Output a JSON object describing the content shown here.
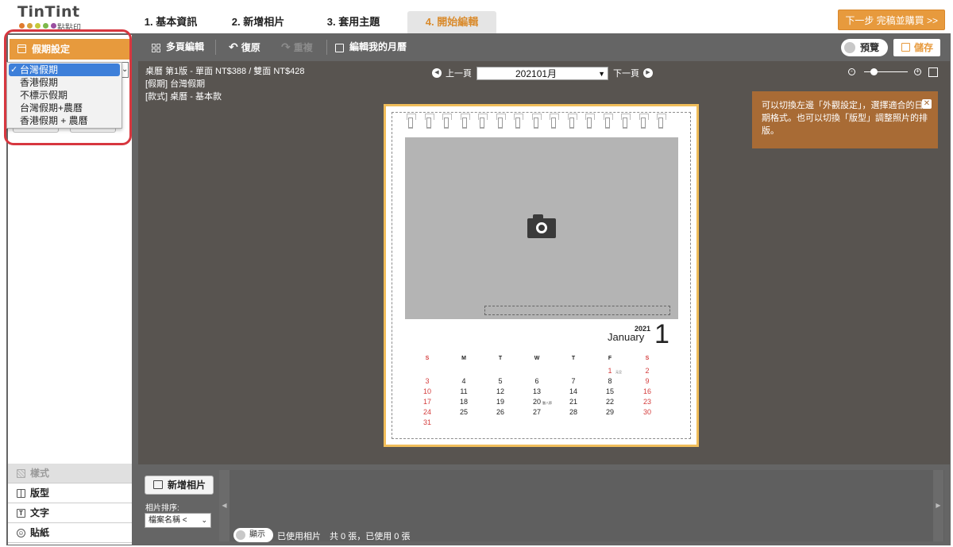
{
  "logo": {
    "text": "TinTint",
    "sub": "點點印",
    "dot_colors": [
      "#e07b2e",
      "#d6a33c",
      "#c5c93a",
      "#7db84b",
      "#9a4fa0"
    ]
  },
  "steps": [
    {
      "label": "1. 基本資訊"
    },
    {
      "label": "2. 新增相片"
    },
    {
      "label": "3. 套用主題"
    },
    {
      "label": "4. 開始編輯"
    }
  ],
  "header": {
    "next_label": "下一步 完稿並購買 >>"
  },
  "toolbar": {
    "multipage": "多頁編輯",
    "undo": "復原",
    "redo": "重複",
    "edit_my_months": "編輯我的月曆",
    "preview": "預覽",
    "save": "儲存"
  },
  "left": {
    "panel_title": "假期設定",
    "holiday_options": [
      {
        "label": "台灣假期",
        "selected": true
      },
      {
        "label": "香港假期"
      },
      {
        "label": "不標示假期"
      },
      {
        "label": "台灣假期+農曆"
      },
      {
        "label": "香港假期 + 農曆"
      }
    ],
    "tabs": [
      {
        "label": "樣式",
        "disabled": true
      },
      {
        "label": "版型"
      },
      {
        "label": "文字"
      },
      {
        "label": "貼紙"
      }
    ]
  },
  "canvas": {
    "info_lines": [
      "桌曆 第1版 - 單面 NT$388 / 雙面 NT$428",
      "[假期] 台灣假期",
      "[款式] 桌曆 - 基本款"
    ],
    "prev_page": "上一頁",
    "next_page": "下一頁",
    "month_select": "202101月",
    "tooltip": "可以切換左邊「外觀設定」，選擇適合的日期格式。也可以切換「版型」調整照片的排版。",
    "tooltip_close": "✕"
  },
  "calendar": {
    "year": "2021",
    "month_name": "January",
    "month_num": "1",
    "dow": [
      "S",
      "M",
      "T",
      "W",
      "T",
      "F",
      "S"
    ],
    "weeks": [
      [
        "",
        "",
        "",
        "",
        "",
        "1",
        "2"
      ],
      [
        "3",
        "4",
        "5",
        "6",
        "7",
        "8",
        "9"
      ],
      [
        "10",
        "11",
        "12",
        "13",
        "14",
        "15",
        "16"
      ],
      [
        "17",
        "18",
        "19",
        "20",
        "21",
        "22",
        "23"
      ],
      [
        "24",
        "25",
        "26",
        "27",
        "28",
        "29",
        "30"
      ],
      [
        "31",
        "",
        "",
        "",
        "",
        "",
        ""
      ]
    ],
    "red_dates": [
      "1",
      "2",
      "3",
      "9",
      "10",
      "16",
      "17",
      "23",
      "24",
      "30",
      "31"
    ],
    "notes": [
      {
        "date": "1",
        "text": "元旦"
      },
      {
        "date": "20",
        "text": "臘八節"
      }
    ],
    "accent_red": "#d43c3c"
  },
  "bottom": {
    "add_photo": "新增相片",
    "sort_label": "相片排序:",
    "sort_value": "檔案名稱 <",
    "show_toggle": "顯示",
    "used_text": "已使用相片　共 0 張，已使用 0 張"
  },
  "colors": {
    "accent": "#e79a3d",
    "tooltip": "#a86b35",
    "highlight": "#d7373f"
  }
}
